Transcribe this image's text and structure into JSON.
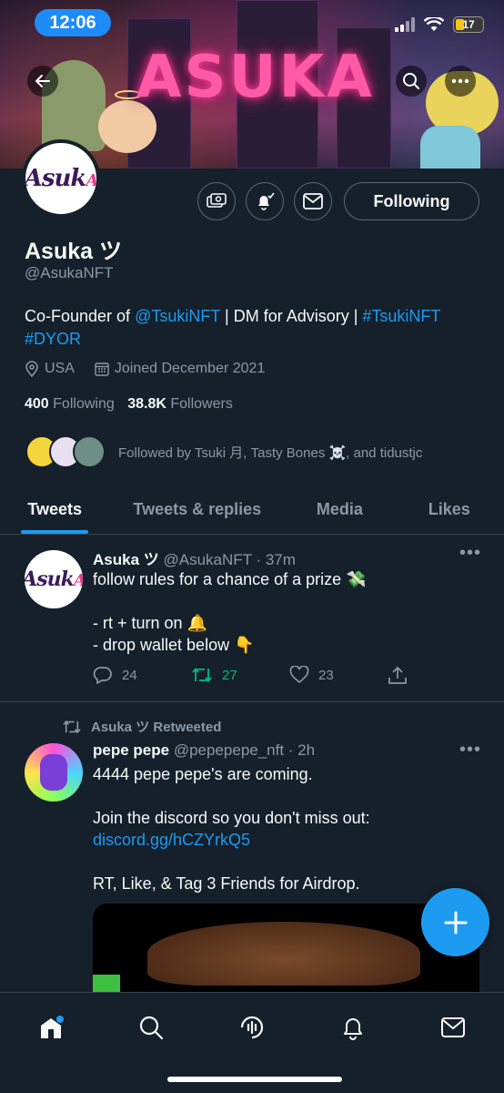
{
  "status_bar": {
    "time": "12:06",
    "battery": "17"
  },
  "banner": {
    "title": "ASUKA"
  },
  "profile": {
    "name": "Asuka ツ",
    "handle": "@AsukaNFT",
    "avatar_text": "Asuk",
    "avatar_text_accent": "A",
    "bio_prefix": "Co-Founder of ",
    "bio_mention": "@TsukiNFT",
    "bio_middle": " | DM for Advisory | ",
    "bio_hashtag1": "#TsukiNFT",
    "bio_hashtag2": "#DYOR",
    "location": "USA",
    "joined": "Joined December 2021",
    "following_count": "400",
    "following_label": "Following",
    "followers_count": "38.8K",
    "followers_label": "Followers",
    "followed_by": "Followed by Tsuki 月, Tasty Bones ☠️, and tidustjc",
    "follow_button": "Following"
  },
  "tabs": [
    "Tweets",
    "Tweets & replies",
    "Media",
    "Likes"
  ],
  "tweets": [
    {
      "name": "Asuka ツ",
      "meta": "@AsukaNFT · 37m",
      "line1": "follow rules for a chance of a prize 💸",
      "line2": "- rt + turn on 🔔",
      "line3": "- drop wallet below 👇",
      "replies": "24",
      "retweets": "27",
      "likes": "23"
    },
    {
      "retweeted_by": "Asuka ツ Retweeted",
      "name": "pepe pepe",
      "meta": "@pepepepe_nft · 2h",
      "line1": "4444 pepe pepe's are coming.",
      "line2": "Join the discord so you don't miss out:",
      "link": "discord.gg/hCZYrkQ5",
      "line3": "RT, Like, & Tag 3 Friends for Airdrop."
    }
  ],
  "colors": {
    "accent": "#1d9bf0",
    "background": "#15202b",
    "retweet_green": "#00ba7c"
  }
}
